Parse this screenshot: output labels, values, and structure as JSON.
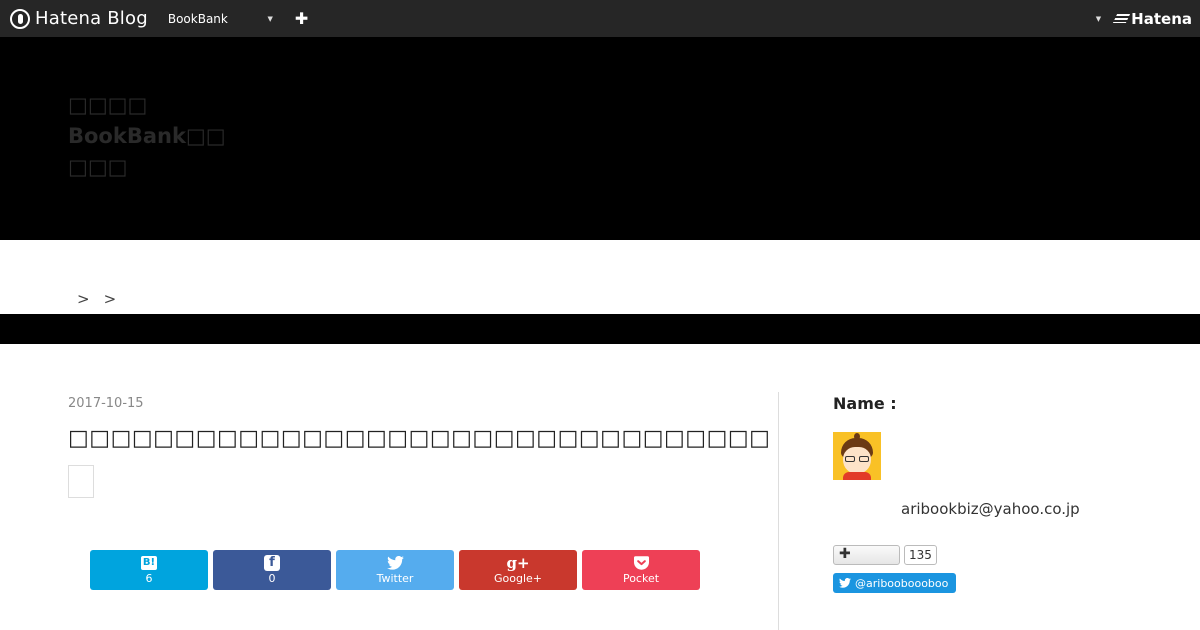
{
  "globalbar": {
    "brand": "Hatena Blog",
    "blog_selector": "BookBank",
    "add_symbol": "✚",
    "hatena_logo": "Hatena"
  },
  "header": {
    "title_lines": [
      "□□□□",
      "BookBank□□",
      "□□□"
    ]
  },
  "breadcrumb": {
    "separators": [
      ">",
      ">"
    ]
  },
  "entry": {
    "date": "2017-10-15",
    "title": "□□□□□□□□□□□□□□□□□□□□□□□□□□□□□□□□□□□□□□"
  },
  "share": {
    "hatebu": {
      "count": "6",
      "icon": "B!"
    },
    "facebook": {
      "count": "0",
      "icon": "f"
    },
    "twitter": {
      "label": "Twitter"
    },
    "googleplus": {
      "label": "Google+",
      "icon": "g+"
    },
    "pocket": {
      "label": "Pocket"
    }
  },
  "sidebar": {
    "name_label": "Name :",
    "email": "aribookbiz@yahoo.co.jp",
    "hatena_follow_count": "135",
    "twitter_handle": "@aribooboooboo"
  },
  "colors": {
    "hatebu": "#00a4de",
    "facebook": "#3b5998",
    "twitter": "#55acee",
    "googleplus": "#c9382d",
    "pocket": "#ee4056",
    "twitter_follow": "#1b95e0"
  }
}
